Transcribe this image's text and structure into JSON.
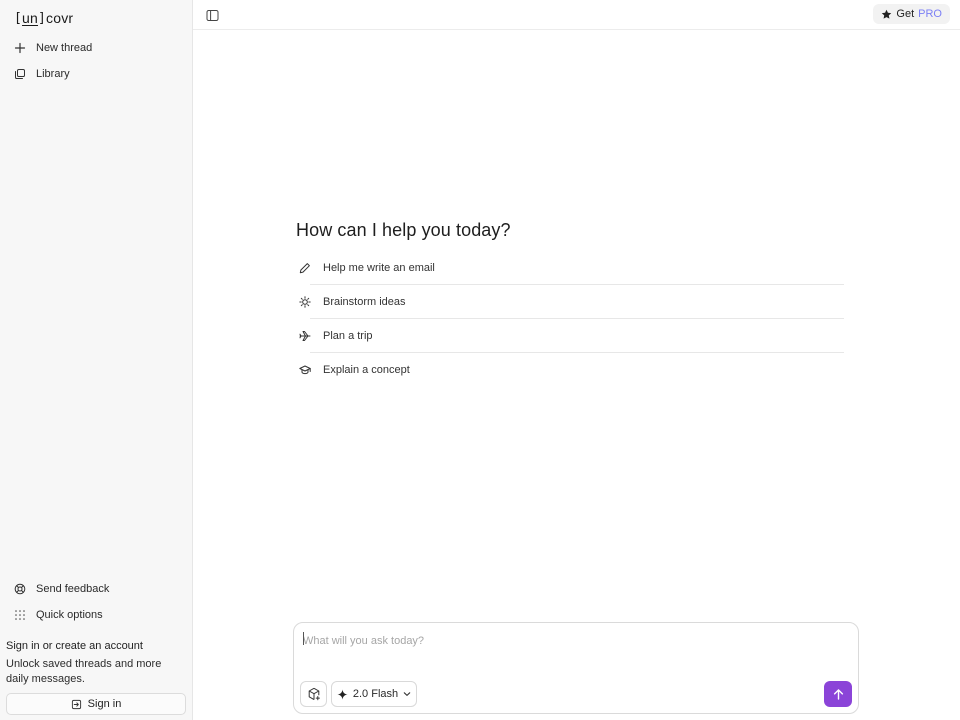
{
  "sidebar": {
    "logo": {
      "bracket_open": "[",
      "un": "un",
      "bracket_close": "]",
      "rest": "covr"
    },
    "items": [
      {
        "label": "New thread",
        "icon": "plus-icon"
      },
      {
        "label": "Library",
        "icon": "library-icon"
      }
    ],
    "bottom_items": [
      {
        "label": "Send feedback",
        "icon": "lifebuoy-icon"
      },
      {
        "label": "Quick options",
        "icon": "grid-dots-icon"
      }
    ],
    "signin": {
      "title": "Sign in or create an account",
      "description": "Unlock saved threads and more daily messages.",
      "button": "Sign in",
      "icon": "sign-in-icon"
    }
  },
  "topbar": {
    "toggle_icon": "sidebar-toggle-icon",
    "pro": {
      "get": "Get",
      "pro": "PRO",
      "icon": "star-icon",
      "accent": "#7b7ff5"
    }
  },
  "main": {
    "heading": "How can I help you today?",
    "suggestions": [
      {
        "label": "Help me write an email",
        "icon": "pencil-icon"
      },
      {
        "label": "Brainstorm ideas",
        "icon": "lightbulb-icon"
      },
      {
        "label": "Plan a trip",
        "icon": "plane-icon"
      },
      {
        "label": "Explain a concept",
        "icon": "graduation-cap-icon"
      }
    ]
  },
  "composer": {
    "placeholder": "What will you ask today?",
    "value": "",
    "model": "2.0 Flash",
    "send_color": "#8b44d8"
  }
}
